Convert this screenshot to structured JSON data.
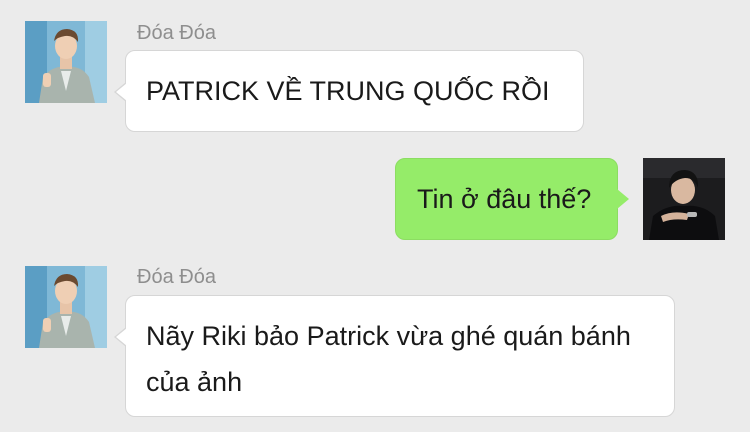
{
  "messages": [
    {
      "direction": "incoming",
      "sender": "Đóa Đóa",
      "avatar_icon": "avatar-man-grey-suit-photo",
      "text": "PATRICK VỀ TRUNG QUỐC RỒI"
    },
    {
      "direction": "outgoing",
      "sender": "",
      "avatar_icon": "avatar-man-dark-photo",
      "text": "Tin ở đâu thế?"
    },
    {
      "direction": "incoming",
      "sender": "Đóa Đóa",
      "avatar_icon": "avatar-man-grey-suit-photo",
      "text": "Nãy Riki bảo Patrick vừa ghé quán bánh của ảnh"
    }
  ],
  "colors": {
    "background": "#ebebeb",
    "incoming_bubble": "#ffffff",
    "outgoing_bubble": "#95ec69",
    "sender_name": "#8e8e8e",
    "message_text": "#1a1a1a"
  }
}
